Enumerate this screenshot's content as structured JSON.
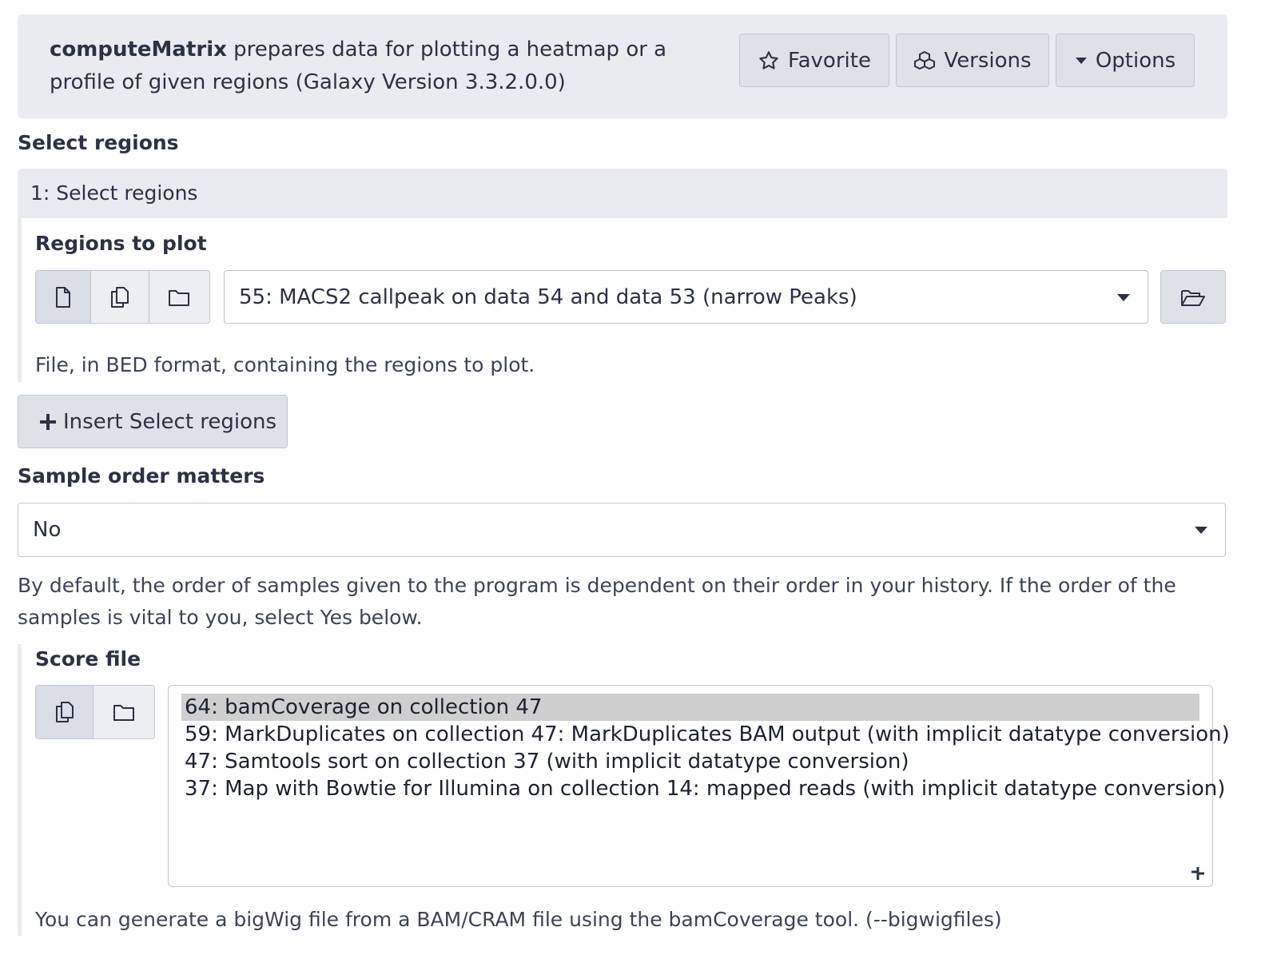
{
  "tool": {
    "name": "computeMatrix",
    "description": " prepares data for plotting a heatmap or a profile of given regions (Galaxy Version 3.3.2.0.0)",
    "buttons": {
      "favorite": "Favorite",
      "versions": "Versions",
      "options": "Options"
    }
  },
  "select_regions": {
    "section_label": "Select regions",
    "repeat_title": "1: Select regions",
    "regions_label": "Regions to plot",
    "selected_value": "55: MACS2 callpeak on data 54 and data 53 (narrow Peaks)",
    "help": "File, in BED format, containing the regions to plot.",
    "insert_label": "Insert Select regions"
  },
  "sample_order": {
    "label": "Sample order matters",
    "selected_value": "No",
    "help": "By default, the order of samples given to the program is dependent on their order in your history. If the order of the samples is vital to you, select Yes below."
  },
  "score_file": {
    "label": "Score file",
    "options": [
      {
        "text": "64: bamCoverage on collection 47",
        "selected": true
      },
      {
        "text": "59: MarkDuplicates on collection 47: MarkDuplicates BAM output (with implicit datatype conversion)",
        "selected": false
      },
      {
        "text": "47: Samtools sort on collection 37 (with implicit datatype conversion)",
        "selected": false
      },
      {
        "text": "37: Map with Bowtie for Illumina on collection 14: mapped reads (with implicit datatype conversion)",
        "selected": false
      }
    ],
    "help": "You can generate a bigWig file from a BAM/CRAM file using the bamCoverage tool. (--bigwigfiles)"
  },
  "colors": {
    "panel_bg": "#e9ebf0",
    "button_bg": "#dee2e8",
    "border": "#c0c6d1",
    "text": "#2c3143",
    "selected_option_bg": "#cfcfcf"
  }
}
